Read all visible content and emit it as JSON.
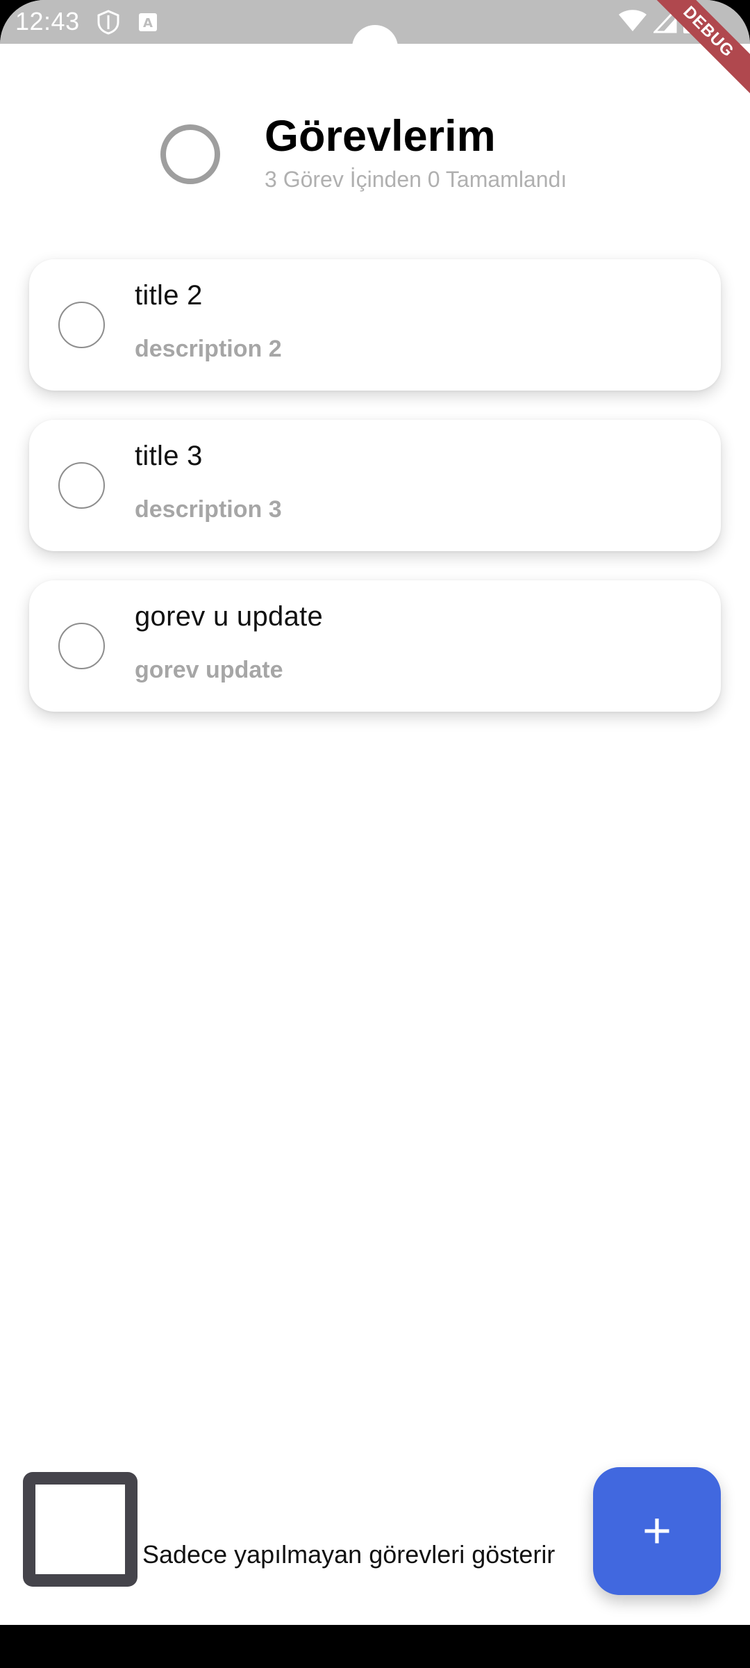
{
  "status_bar": {
    "time": "12:43",
    "left_icons": [
      "shield-icon",
      "keyboard-a-icon"
    ],
    "right_icons": [
      "wifi-icon",
      "signal-icon",
      "battery-icon"
    ],
    "debug_label": "DEBUG"
  },
  "header": {
    "title": "Görevlerim",
    "subtitle": "3 Görev İçinden 0 Tamamlandı",
    "progress_fraction": 0
  },
  "tasks": [
    {
      "title": "title 2",
      "description": "description 2",
      "done": false
    },
    {
      "title": "title 3",
      "description": "description 3",
      "done": false
    },
    {
      "title": "gorev u update",
      "description": "gorev update",
      "done": false
    }
  ],
  "filter": {
    "label": "Sadece yapılmayan görevleri gösterir",
    "checked": false
  },
  "fab": {
    "label": "+"
  },
  "colors": {
    "accent": "#4168df",
    "status_bar": "#bdbdbd",
    "debug_banner": "#b0484e",
    "muted_text": "#a6a6a6"
  }
}
